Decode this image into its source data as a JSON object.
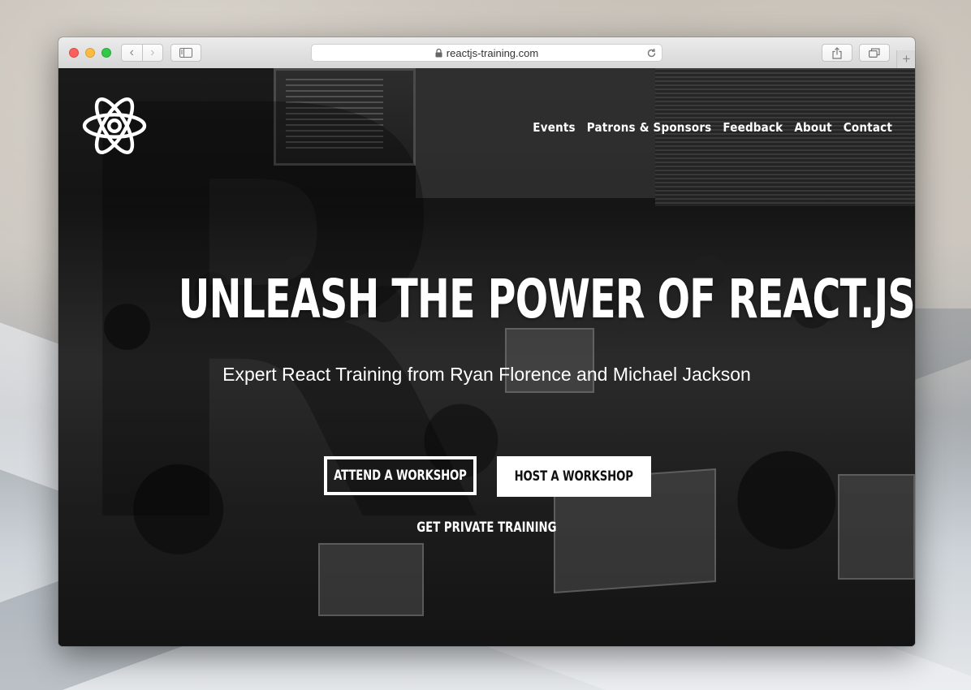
{
  "browser": {
    "address": "reactjs-training.com",
    "icons": {
      "back": "chevron-left-icon",
      "forward": "chevron-right-icon",
      "sidebar": "sidebar-icon",
      "lock": "lock-icon",
      "reload": "reload-icon",
      "share": "share-icon",
      "tabs": "tabs-icon",
      "new_tab": "plus-icon"
    }
  },
  "site": {
    "nav": [
      "Events",
      "Patrons & Sponsors",
      "Feedback",
      "About",
      "Contact"
    ],
    "hero_title": "UNLEASH THE POWER OF REACT.JS",
    "subtitle": "Expert React Training from Ryan Florence and Michael Jackson",
    "buttons": {
      "attend": "ATTEND A WORKSHOP",
      "host": "HOST A WORKSHOP",
      "private": "GET PRIVATE TRAINING"
    },
    "colors": {
      "text": "#ffffff",
      "overlay": "#000000"
    }
  }
}
